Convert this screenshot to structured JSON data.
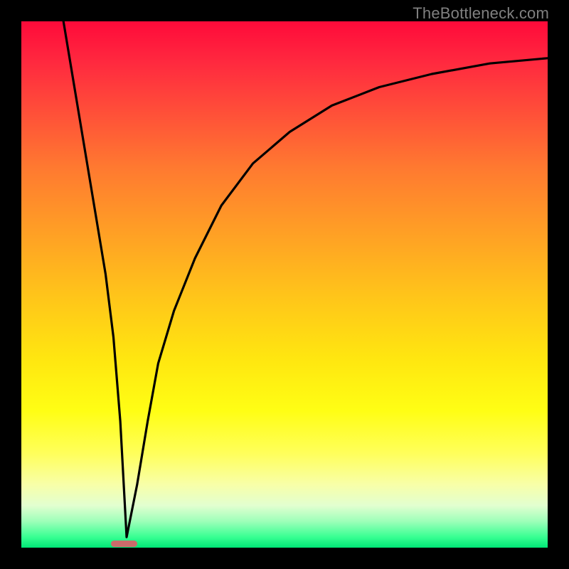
{
  "watermark": "TheBottleneck.com",
  "chart_data": {
    "type": "line",
    "title": "",
    "xlabel": "",
    "ylabel": "",
    "xlim": [
      0,
      100
    ],
    "ylim": [
      0,
      100
    ],
    "grid": false,
    "gradient_background": {
      "top": "#ff0a3a",
      "bottom": "#00e676",
      "description": "red→orange→yellow→green vertical gradient"
    },
    "series": [
      {
        "name": "curve",
        "x": [
          8,
          10,
          12,
          14,
          16,
          17.5,
          18.8,
          20,
          22,
          24,
          26,
          29,
          33,
          38,
          44,
          51,
          59,
          68,
          78,
          89,
          100
        ],
        "values": [
          100,
          88,
          76,
          64,
          52,
          40,
          24,
          2,
          12,
          24,
          35,
          45,
          55,
          65,
          73,
          79,
          84,
          87.5,
          90,
          92,
          93
        ],
        "note": "y is percent height from bottom; piecewise: steep linear descent then bottleneck curve rising"
      }
    ],
    "marker": {
      "x": 19.5,
      "y": 0.2,
      "width_pct": 5.0,
      "height_pct": 1.2,
      "color": "#cb6b6b"
    }
  }
}
